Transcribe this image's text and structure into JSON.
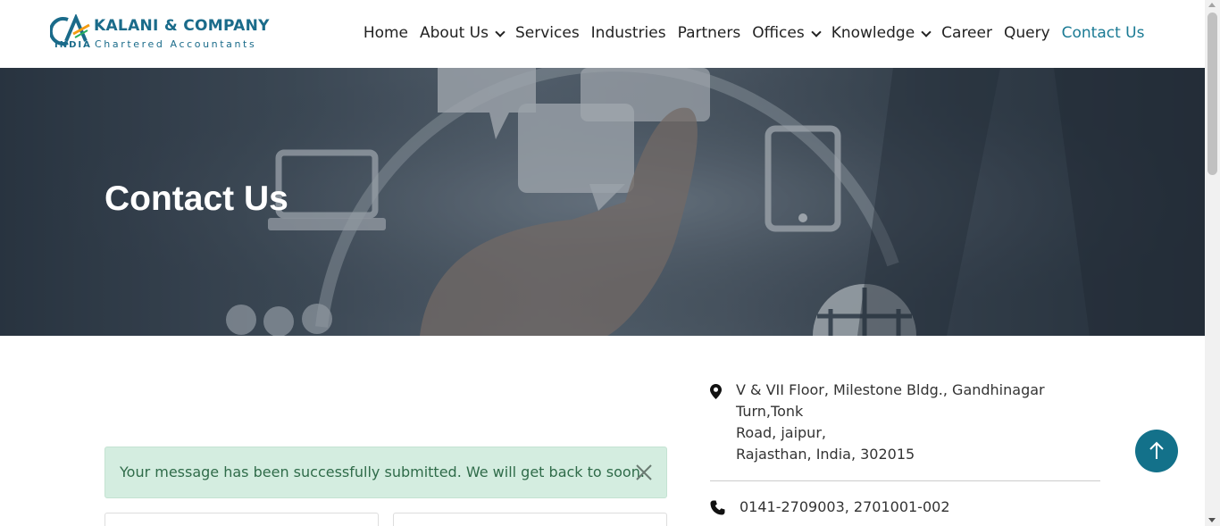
{
  "brand": {
    "logo_mark": "CA",
    "logo_country": "INDIA",
    "name": "KALANI & COMPANY",
    "tagline": "Chartered Accountants",
    "color": "#1a6b8a"
  },
  "nav": {
    "items": [
      {
        "label": "Home",
        "dropdown": false
      },
      {
        "label": "About Us",
        "dropdown": true
      },
      {
        "label": "Services",
        "dropdown": false
      },
      {
        "label": "Industries",
        "dropdown": false
      },
      {
        "label": "Partners",
        "dropdown": false
      },
      {
        "label": "Offices",
        "dropdown": true
      },
      {
        "label": "Knowledge",
        "dropdown": true
      },
      {
        "label": "Career",
        "dropdown": false
      },
      {
        "label": "Query",
        "dropdown": false
      },
      {
        "label": "Contact Us",
        "dropdown": false,
        "active": true
      }
    ],
    "active_color": "#1a7a94"
  },
  "hero": {
    "title": "Contact Us"
  },
  "alert": {
    "message": "Your message has been successfully submitted. We will get back to soon.",
    "close_icon": "close-icon"
  },
  "contact": {
    "address_line1": "V & VII Floor, Milestone Bldg., Gandhinagar Turn,Tonk",
    "address_line2": "Road, jaipur,",
    "address_line3": "Rajasthan, India, 302015",
    "phone": "0141-2709003, 2701001-002",
    "address_icon": "map-marker-icon",
    "phone_icon": "phone-icon"
  },
  "scroll_to_top": {
    "icon": "arrow-up-icon",
    "color": "#13718a"
  }
}
